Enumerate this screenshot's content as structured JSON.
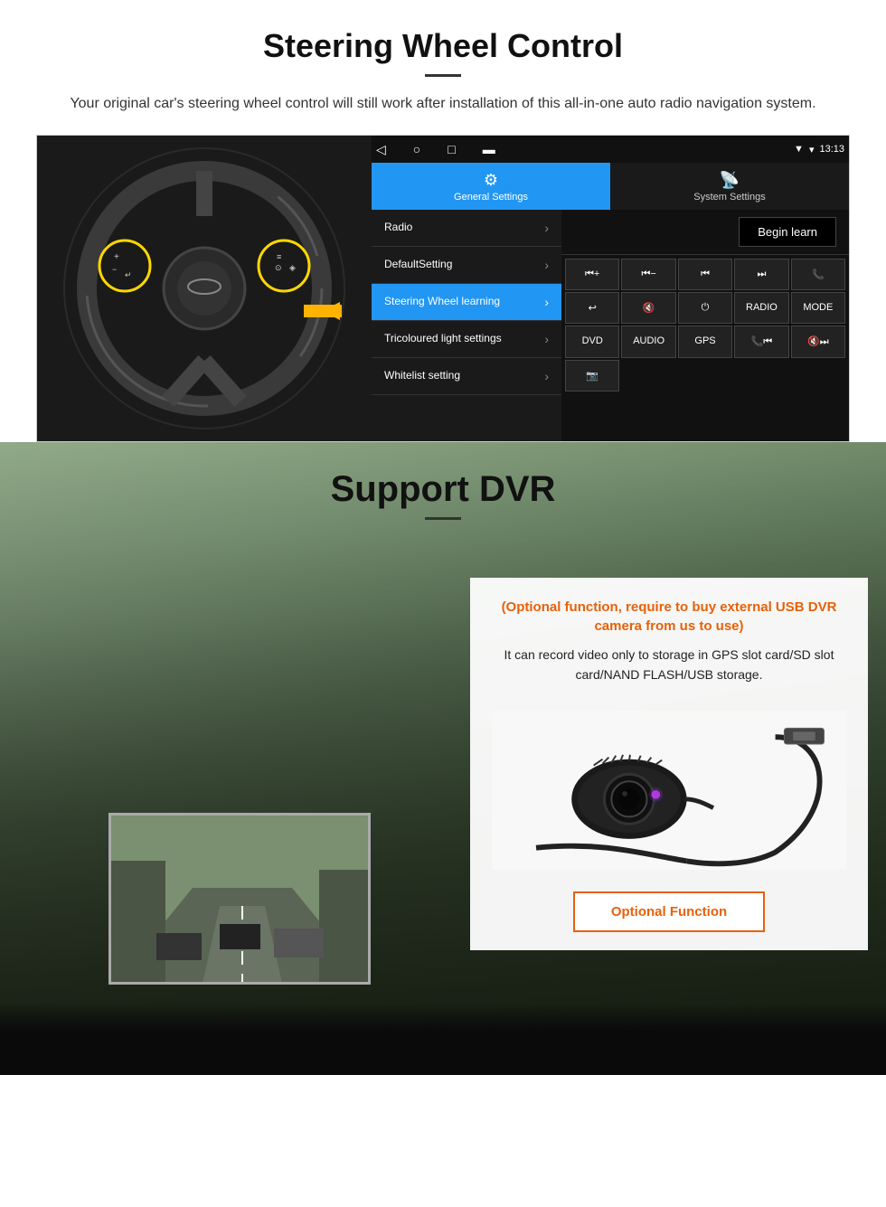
{
  "section1": {
    "title": "Steering Wheel Control",
    "subtitle": "Your original car's steering wheel control will still work after installation of this all-in-one auto radio navigation system.",
    "android": {
      "time": "13:13",
      "nav_icons": [
        "◁",
        "○",
        "□",
        "▬"
      ],
      "tab_general": "General Settings",
      "tab_system": "System Settings",
      "menu_items": [
        {
          "label": "Radio",
          "active": false
        },
        {
          "label": "DefaultSetting",
          "active": false
        },
        {
          "label": "Steering Wheel learning",
          "active": true
        },
        {
          "label": "Tricoloured light settings",
          "active": false
        },
        {
          "label": "Whitelist setting",
          "active": false
        }
      ],
      "begin_learn": "Begin learn",
      "control_buttons_row1": [
        "⏮+",
        "⏮−",
        "⏮",
        "⏭",
        "📞"
      ],
      "control_buttons_row2": [
        "↩",
        "🔇",
        "⏻",
        "RADIO",
        "MODE"
      ],
      "control_buttons_row3": [
        "DVD",
        "AUDIO",
        "GPS",
        "📞⏮",
        "🔇⏭"
      ],
      "control_buttons_row4": [
        "📷"
      ]
    }
  },
  "section2": {
    "title": "Support DVR",
    "optional_text": "(Optional function, require to buy external USB DVR camera from us to use)",
    "desc_text": "It can record video only to storage in GPS slot card/SD slot card/NAND FLASH/USB storage.",
    "optional_function_btn": "Optional Function"
  }
}
